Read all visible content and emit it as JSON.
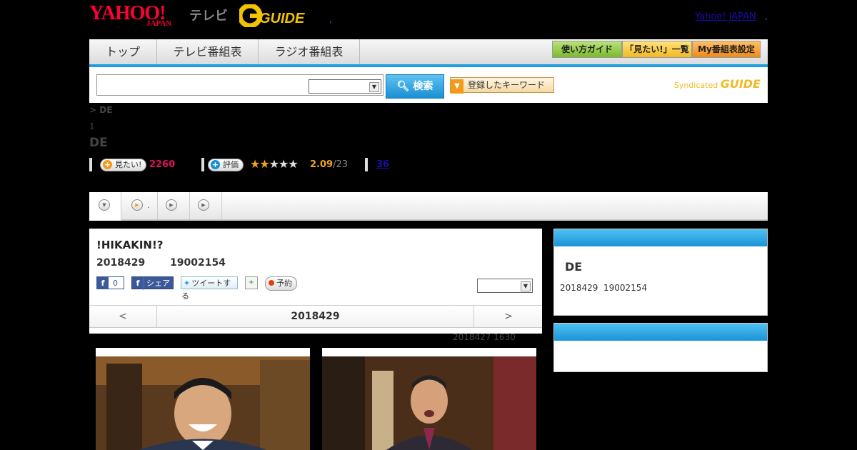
{
  "header": {
    "yahoo_logo": "YAHOO!",
    "japan_logo": "JAPAN",
    "tv_label": "テレビ",
    "gguide_logo": "GUIDE",
    "dot_mark": ",",
    "yahoo_japan_link": "Yahoo! JAPAN"
  },
  "nav": {
    "tabs": [
      {
        "label": "トップ"
      },
      {
        "label": "テレビ番組表"
      },
      {
        "label": "ラジオ番組表"
      }
    ],
    "right_buttons": [
      {
        "label": "使い方ガイド"
      },
      {
        "label": "「見たい!」一覧"
      },
      {
        "label": "My番組表設定"
      }
    ]
  },
  "search": {
    "input_value": "",
    "select_value": "",
    "button_label": "検索",
    "keyword_button_label": "登録したキーワード",
    "syndicated_label": "Syndicated",
    "syndicated_brand": "GUIDE"
  },
  "program": {
    "breadcrumb": "> DE",
    "episode_no": "1",
    "title": "DE",
    "mitai_label": "見たい!",
    "mitai_count": "2260",
    "rate_label": "評価",
    "rating_value": "2.09",
    "rating_total": "/23",
    "stars_filled": 2,
    "stars_total": 5,
    "review_count": "36"
  },
  "subtabs": [
    {
      "label": ""
    },
    {
      "label": "."
    },
    {
      "label": ""
    },
    {
      "label": ""
    }
  ],
  "episode": {
    "title": "!HIKAKIN!?",
    "date": "2018429",
    "time": "19002154",
    "fb_like_count": "0",
    "fb_share_label": "シェア",
    "tweet_label": "ツイートする",
    "reserve_label": "予約",
    "select_value": "",
    "prev_label": "<",
    "current_date": "2018429",
    "next_label": ">",
    "update_note": "2018427  1630"
  },
  "sidebar": {
    "title": "DE",
    "date": "2018429",
    "time": "19002154"
  },
  "colors": {
    "accent_blue": "#1aa0e0",
    "brand_red": "#ff0033",
    "mitai_pink": "#e0105f",
    "star_orange": "#f2a61a"
  }
}
